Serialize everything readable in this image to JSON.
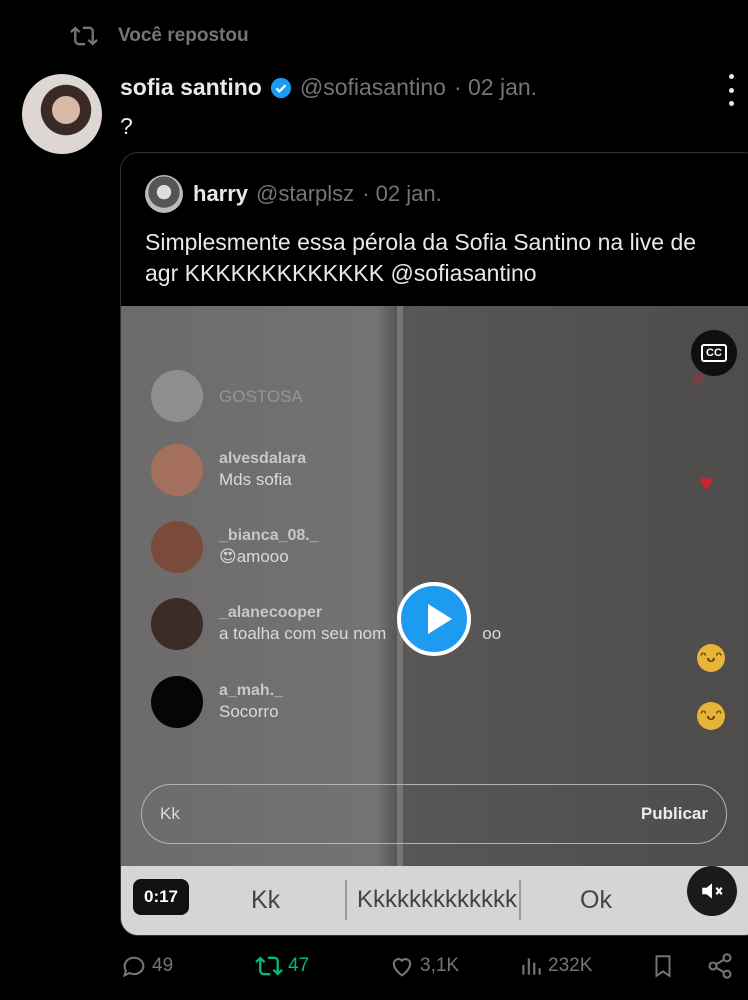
{
  "repost": {
    "label": "Você repostou"
  },
  "tweet": {
    "name": "sofia santino",
    "handle": "@sofiasantino",
    "date": "· 02 jan.",
    "text": "?"
  },
  "quote": {
    "name": "harry",
    "handle": "@starplsz",
    "date": "· 02 jan.",
    "text": "Simplesmente essa pérola da Sofia Santino na live de agr KKKKKKKKKKKKK @sofiasantino"
  },
  "video": {
    "cc_label": "CC",
    "timer": "0:17",
    "comments": [
      {
        "user": "",
        "msg": "GOSTOSA"
      },
      {
        "user": "alvesdalara",
        "msg": "Mds sofia"
      },
      {
        "user": "_bianca_08._",
        "msg": "😍amooo"
      },
      {
        "user": "_alanecooper",
        "msg": "a toalha com seu nom",
        "msg_end": "oo"
      },
      {
        "user": "a_mah._",
        "msg": "Socorro"
      }
    ],
    "input_text": "Kk",
    "publish_label": "Publicar",
    "suggestions": [
      "Kk",
      "Kkkkkkkkkkkkk",
      "Ok"
    ]
  },
  "actions": {
    "replies": "49",
    "reposts": "47",
    "likes": "3,1K",
    "views": "232K"
  },
  "colors": {
    "accent": "#1d9bf0",
    "repost_green": "#00ba7c",
    "muted": "#71767b"
  }
}
